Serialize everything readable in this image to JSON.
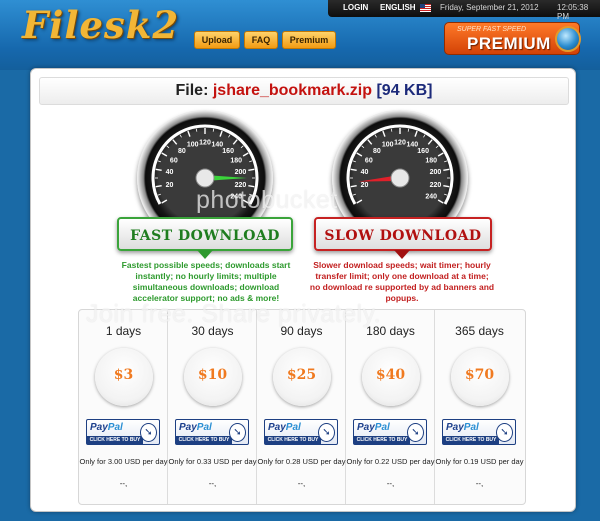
{
  "header": {
    "logo_text": "Filesk2",
    "top_links": {
      "login": "LOGIN",
      "language": "ENGLISH",
      "date": "Friday, September 21, 2012",
      "time": "12:05:38 PM"
    },
    "nav": [
      {
        "label": "Upload"
      },
      {
        "label": "FAQ"
      },
      {
        "label": "Premium"
      }
    ],
    "premium_banner": {
      "subtitle": "SUPER FAST SPEED",
      "label": "PREMIUM"
    }
  },
  "file": {
    "prefix": "File:",
    "name": "jshare_bookmark.zip",
    "size": "[94 KB]"
  },
  "gauges": {
    "ticks": [
      "20",
      "40",
      "60",
      "80",
      "100",
      "120",
      "140",
      "160",
      "180",
      "200",
      "220",
      "240"
    ],
    "fast_value": 210,
    "slow_value": 25
  },
  "fast": {
    "label": "FAST DOWNLOAD",
    "description": "Fastest possible speeds; downloads start instantly; no hourly limits; multiple simultaneous downloads; download accelerator support; no ads & more!"
  },
  "slow": {
    "label": "SLOW DOWNLOAD",
    "description": "Slower download speeds; wait timer; hourly transfer limit; only one download at a time; no download re supported by ad banners and popups."
  },
  "plans": [
    {
      "days": "1 days",
      "price": "$3",
      "per_day": "Only for 3.00 USD per day",
      "extra": "--,"
    },
    {
      "days": "30 days",
      "price": "$10",
      "per_day": "Only for 0.33 USD per day",
      "extra": "--,"
    },
    {
      "days": "90 days",
      "price": "$25",
      "per_day": "Only for 0.28 USD per day",
      "extra": "--,"
    },
    {
      "days": "180 days",
      "price": "$40",
      "per_day": "Only for 0.22 USD per day",
      "extra": "--,"
    },
    {
      "days": "365 days",
      "price": "$70",
      "per_day": "Only for 0.19 USD per day",
      "extra": "--,"
    }
  ],
  "paypal": {
    "brand_a": "Pay",
    "brand_b": "Pal",
    "button": "CLICK HERE TO BUY",
    "icon": "cursor-icon"
  },
  "watermark": {
    "brand": "photobucket",
    "tagline": "Join free. Share privately."
  },
  "colors": {
    "accent_orange": "#f07a20",
    "fast_green": "#2e9a2e",
    "slow_red": "#c21f1f",
    "header_blue": "#1668ad"
  }
}
